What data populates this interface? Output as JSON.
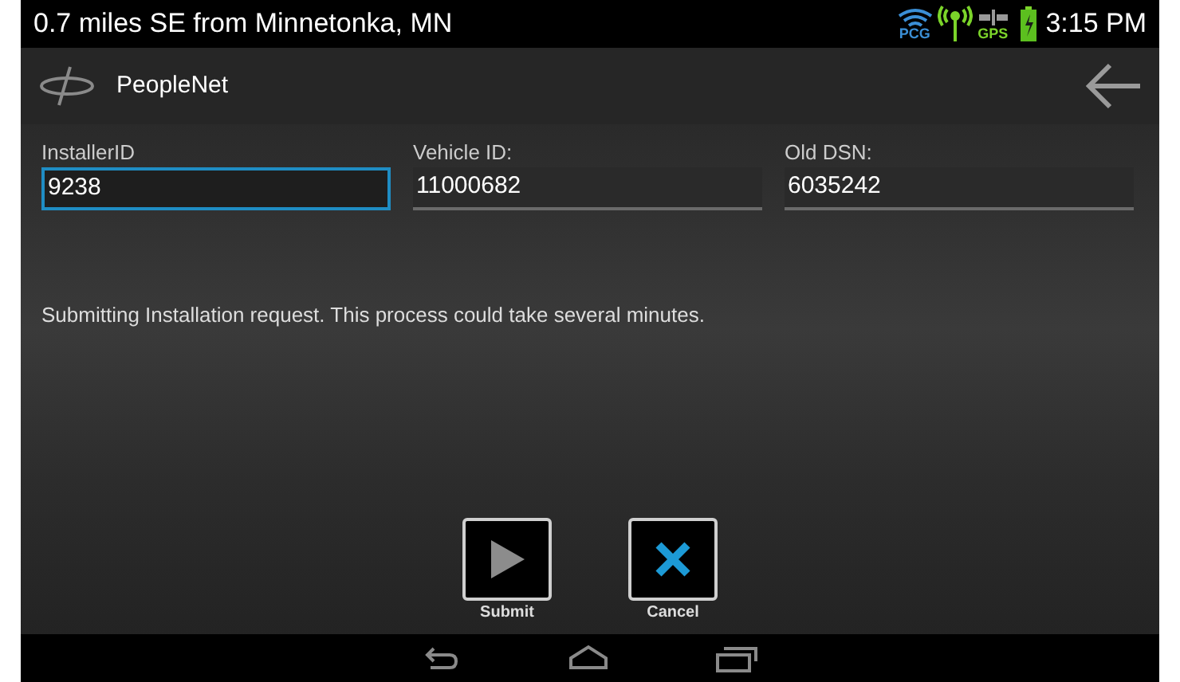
{
  "status_bar": {
    "location": "0.7 miles SE from Minnetonka, MN",
    "icons": [
      {
        "kind": "wifi",
        "label": "PCG"
      },
      {
        "kind": "signal"
      },
      {
        "kind": "gps",
        "label": "GPS"
      },
      {
        "kind": "battery"
      }
    ],
    "time": "3:15 PM"
  },
  "app_bar": {
    "title": "PeopleNet"
  },
  "fields": [
    {
      "label": "InstallerID",
      "value": "9238",
      "focused": true
    },
    {
      "label": "Vehicle ID:",
      "value": "11000682",
      "focused": false
    },
    {
      "label": "Old DSN:",
      "value": "6035242",
      "focused": false
    }
  ],
  "message": "Submitting Installation request. This process could take several minutes.",
  "buttons": [
    {
      "kind": "submit",
      "label": "Submit"
    },
    {
      "kind": "cancel",
      "label": "Cancel"
    }
  ],
  "nav_bar": [
    {
      "kind": "back"
    },
    {
      "kind": "home"
    },
    {
      "kind": "recents"
    }
  ]
}
